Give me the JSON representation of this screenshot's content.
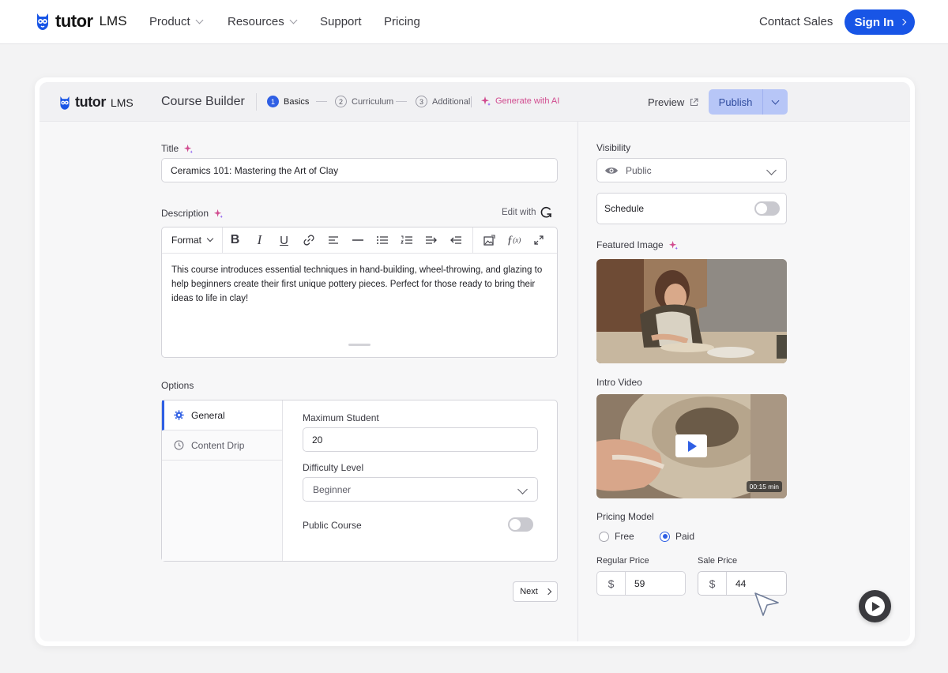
{
  "topnav": {
    "brand": "tutor",
    "brand_suffix": "LMS",
    "items": [
      {
        "label": "Product",
        "has_dropdown": true
      },
      {
        "label": "Resources",
        "has_dropdown": true
      },
      {
        "label": "Support",
        "has_dropdown": false
      },
      {
        "label": "Pricing",
        "has_dropdown": false
      }
    ],
    "contact": "Contact Sales",
    "signin": "Sign In"
  },
  "builder": {
    "brand": "tutor",
    "brand_suffix": "LMS",
    "title": "Course Builder",
    "steps": [
      {
        "num": "1",
        "label": "Basics",
        "active": true
      },
      {
        "num": "2",
        "label": "Curriculum",
        "active": false
      },
      {
        "num": "3",
        "label": "Additional",
        "active": false
      }
    ],
    "generate_ai": "Generate with AI",
    "preview": "Preview",
    "publish": "Publish"
  },
  "form": {
    "title_label": "Title",
    "title_value": "Ceramics 101: Mastering the Art of Clay",
    "description_label": "Description",
    "edit_with": "Edit with",
    "toolbar_format": "Format",
    "description_text": "This course introduces essential techniques in hand-building, wheel-throwing, and glazing to help beginners create their first unique pottery pieces. Perfect for those ready to bring their ideas to life in clay!",
    "options_label": "Options",
    "option_tabs": [
      {
        "label": "General",
        "icon": "gear-icon",
        "active": true
      },
      {
        "label": "Content Drip",
        "icon": "clock-icon",
        "active": false
      }
    ],
    "max_student_label": "Maximum Student",
    "max_student_value": "20",
    "difficulty_label": "Difficulty Level",
    "difficulty_value": "Beginner",
    "public_course_label": "Public Course",
    "public_course_on": false,
    "next": "Next"
  },
  "side": {
    "visibility_label": "Visibility",
    "visibility_value": "Public",
    "schedule_label": "Schedule",
    "schedule_on": false,
    "featured_label": "Featured Image",
    "intro_label": "Intro Video",
    "video_duration": "00:15 min",
    "pricing_label": "Pricing Model",
    "pricing_options": [
      "Free",
      "Paid"
    ],
    "pricing_selected": "Paid",
    "regular_label": "Regular Price",
    "regular_value": "59",
    "sale_label": "Sale Price",
    "sale_value": "44",
    "currency": "$"
  },
  "colors": {
    "accent": "#1855e6",
    "step_active": "#2f5fe4",
    "publish_bg": "#b7c6f7",
    "ai_pink": "#d14b8f"
  }
}
